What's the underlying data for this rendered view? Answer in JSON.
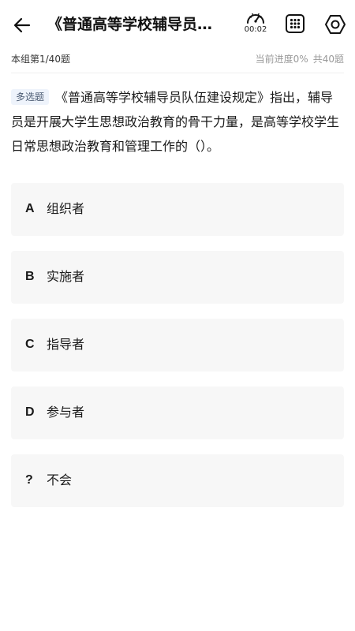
{
  "header": {
    "back_icon": "arrow-left-icon",
    "title": "《普通高等学校辅导员队伍建设规定》",
    "timer": "00:02",
    "timer_icon": "speedometer-icon",
    "grid_icon": "grid-icon",
    "settings_icon": "settings-icon"
  },
  "progress": {
    "group_label": "本组第1/40题",
    "current_progress": "当前进度0%",
    "total": "共40题"
  },
  "question": {
    "type_badge": "多选题",
    "text": "《普通高等学校辅导员队伍建设规定》指出，辅导员是开展大学生思想政治教育的骨干力量，是高等学校学生日常思想政治教育和管理工作的（）。"
  },
  "options": [
    {
      "letter": "A",
      "text": "组织者"
    },
    {
      "letter": "B",
      "text": "实施者"
    },
    {
      "letter": "C",
      "text": "指导者"
    },
    {
      "letter": "D",
      "text": "参与者"
    },
    {
      "letter": "?",
      "text": "不会"
    }
  ],
  "colors": {
    "option_bg": "#f7f7f7",
    "badge_bg": "#eef3fb",
    "muted_text": "#9a9a9a"
  }
}
